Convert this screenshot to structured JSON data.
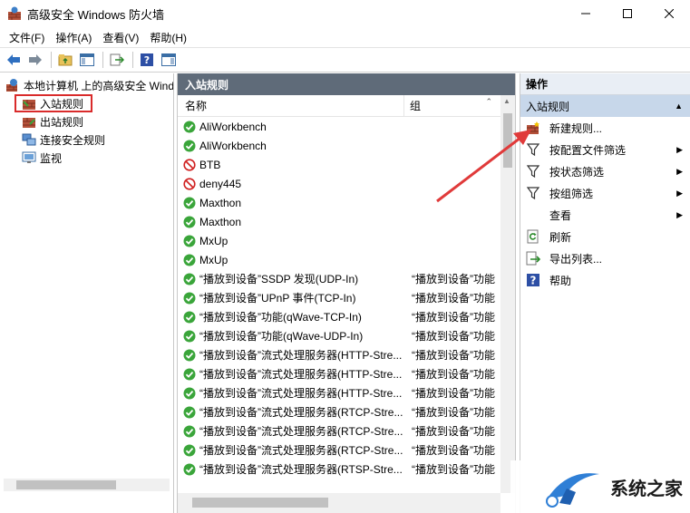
{
  "window": {
    "title": "高级安全 Windows 防火墙",
    "icons": {
      "app": "firewall-app-icon",
      "minimize": "minimize-icon",
      "maximize": "maximize-icon",
      "close": "close-icon"
    }
  },
  "menubar": {
    "items": [
      "文件(F)",
      "操作(A)",
      "查看(V)",
      "帮助(H)"
    ]
  },
  "toolbar": {
    "icons": [
      "back-icon",
      "forward-icon",
      "up-folder-icon",
      "show-hide-tree-icon",
      "export-icon",
      "help-icon",
      "show-hide-action-pane-icon"
    ]
  },
  "tree": {
    "root": "本地计算机 上的高级安全 Windows 防火墙",
    "children": [
      {
        "label": "入站规则",
        "selected": true
      },
      {
        "label": "出站规则"
      },
      {
        "label": "连接安全规则"
      },
      {
        "label": "监视"
      }
    ]
  },
  "rules_pane": {
    "title": "入站规则",
    "columns": {
      "name": "名称",
      "group": "组"
    },
    "rows": [
      {
        "name": "AliWorkbench",
        "group": "",
        "status": "allow"
      },
      {
        "name": "AliWorkbench",
        "group": "",
        "status": "allow"
      },
      {
        "name": "BTB",
        "group": "",
        "status": "block"
      },
      {
        "name": "deny445",
        "group": "",
        "status": "block"
      },
      {
        "name": "Maxthon",
        "group": "",
        "status": "allow"
      },
      {
        "name": "Maxthon",
        "group": "",
        "status": "allow"
      },
      {
        "name": "MxUp",
        "group": "",
        "status": "allow"
      },
      {
        "name": "MxUp",
        "group": "",
        "status": "allow"
      },
      {
        "name": "“播放到设备”SSDP 发现(UDP-In)",
        "group": "“播放到设备”功能",
        "status": "allow"
      },
      {
        "name": "“播放到设备”UPnP 事件(TCP-In)",
        "group": "“播放到设备”功能",
        "status": "allow"
      },
      {
        "name": "“播放到设备”功能(qWave-TCP-In)",
        "group": "“播放到设备”功能",
        "status": "allow"
      },
      {
        "name": "“播放到设备”功能(qWave-UDP-In)",
        "group": "“播放到设备”功能",
        "status": "allow"
      },
      {
        "name": "“播放到设备”流式处理服务器(HTTP-Stre...",
        "group": "“播放到设备”功能",
        "status": "allow"
      },
      {
        "name": "“播放到设备”流式处理服务器(HTTP-Stre...",
        "group": "“播放到设备”功能",
        "status": "allow"
      },
      {
        "name": "“播放到设备”流式处理服务器(HTTP-Stre...",
        "group": "“播放到设备”功能",
        "status": "allow"
      },
      {
        "name": "“播放到设备”流式处理服务器(RTCP-Stre...",
        "group": "“播放到设备”功能",
        "status": "allow"
      },
      {
        "name": "“播放到设备”流式处理服务器(RTCP-Stre...",
        "group": "“播放到设备”功能",
        "status": "allow"
      },
      {
        "name": "“播放到设备”流式处理服务器(RTCP-Stre...",
        "group": "“播放到设备”功能",
        "status": "allow"
      },
      {
        "name": "“播放到设备”流式处理服务器(RTSP-Stre...",
        "group": "“播放到设备”功能",
        "status": "allow"
      }
    ]
  },
  "actions": {
    "header": "操作",
    "section": "入站规则",
    "items": [
      {
        "label": "新建规则...",
        "icon": "new-rule-icon",
        "submenu": false
      },
      {
        "label": "按配置文件筛选",
        "icon": "filter-icon",
        "submenu": true
      },
      {
        "label": "按状态筛选",
        "icon": "filter-icon",
        "submenu": true
      },
      {
        "label": "按组筛选",
        "icon": "filter-icon",
        "submenu": true
      },
      {
        "label": "查看",
        "icon": "",
        "submenu": true
      },
      {
        "label": "刷新",
        "icon": "refresh-icon",
        "submenu": false
      },
      {
        "label": "导出列表...",
        "icon": "export-list-icon",
        "submenu": false
      },
      {
        "label": "帮助",
        "icon": "help-icon",
        "submenu": false
      }
    ]
  },
  "watermark": {
    "text": "系统之家"
  },
  "colors": {
    "annotation": "#e03a3a",
    "pane_header": "#5f6b79",
    "action_section": "#c7d7ea",
    "allow": "#3aa53a",
    "block": "#d02020"
  }
}
